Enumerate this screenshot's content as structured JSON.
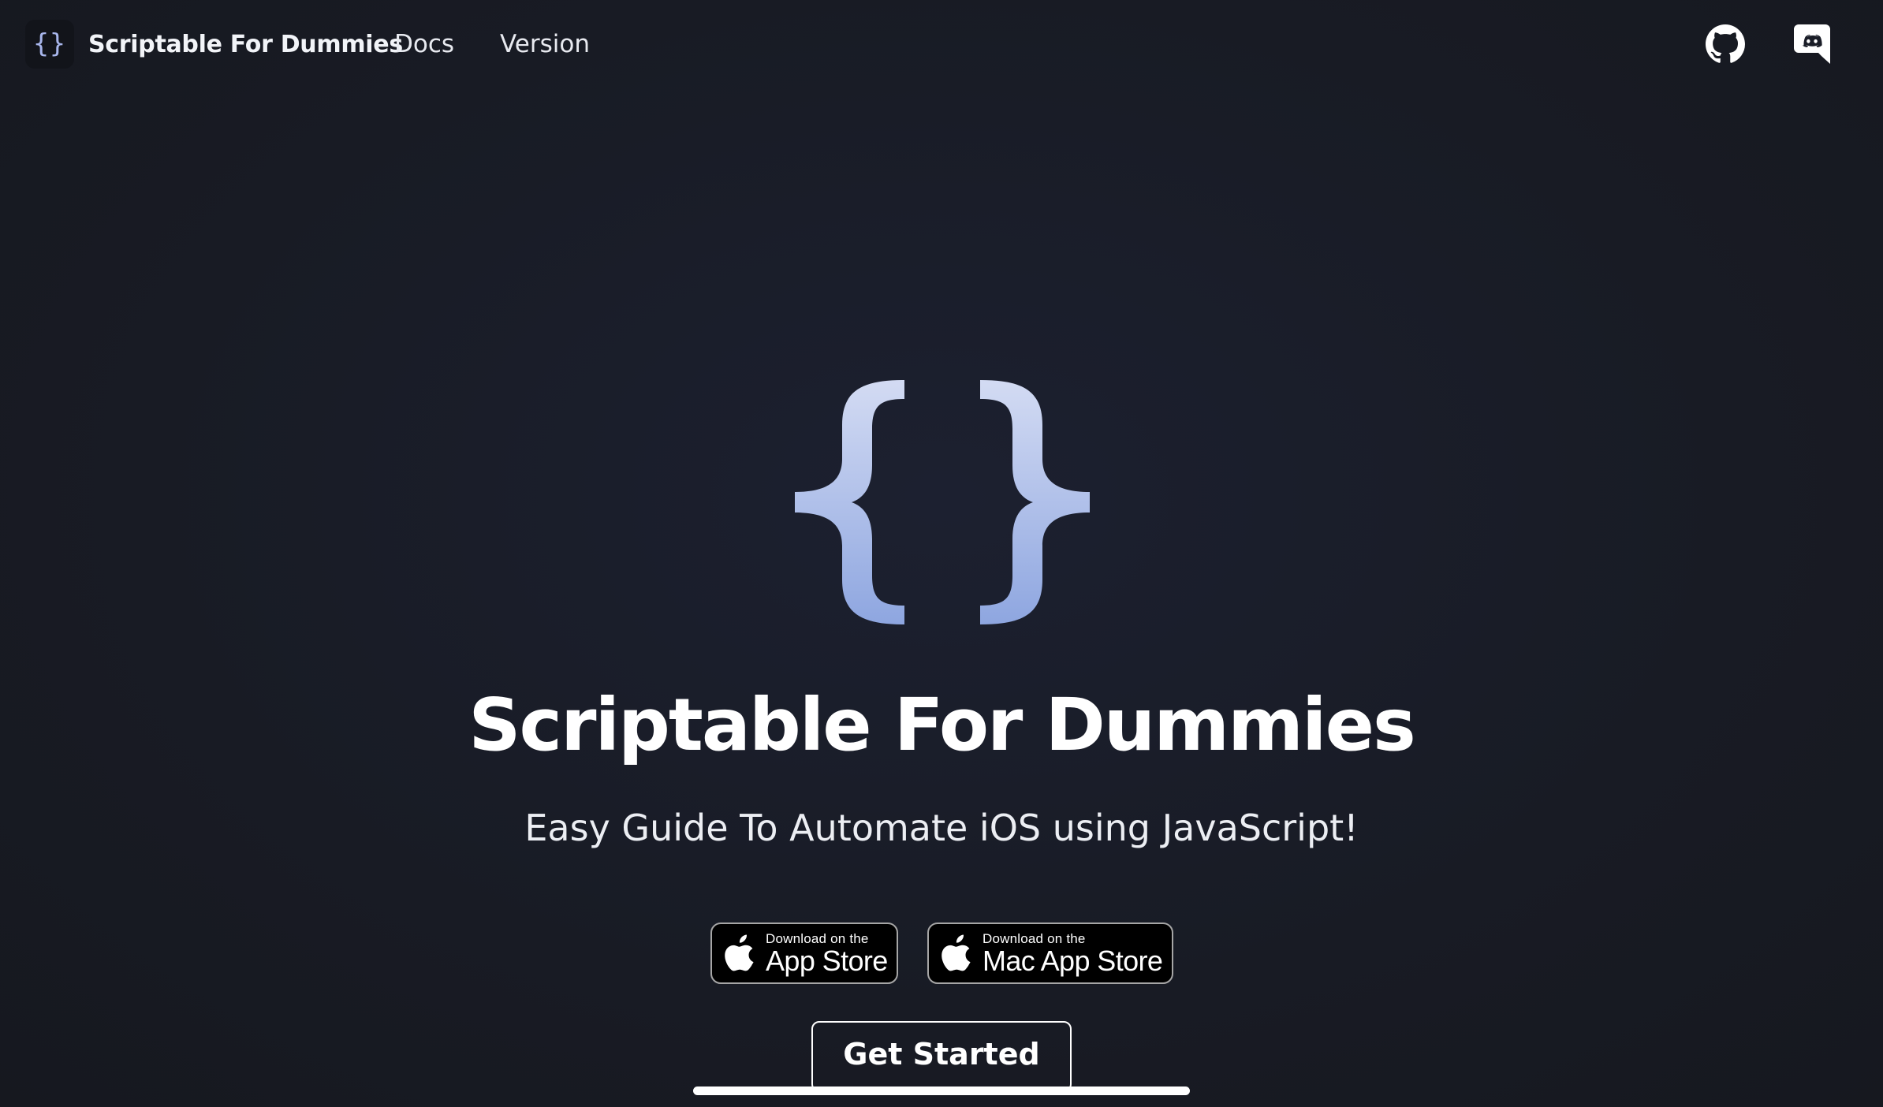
{
  "navbar": {
    "brand_logo_text": "{}",
    "brand_title": "Scriptable For Dummies",
    "links": [
      {
        "label": "Docs"
      },
      {
        "label": "Version"
      }
    ],
    "icons": [
      "github-icon",
      "discord-icon"
    ]
  },
  "hero": {
    "logo_icon": "curly-braces-logo",
    "title": "Scriptable For Dummies",
    "subtitle": "Easy Guide To Automate iOS using JavaScript!",
    "badges": {
      "ios": {
        "small": "Download on the",
        "big": "App Store"
      },
      "mac": {
        "small": "Download on the",
        "big": "Mac App Store"
      }
    },
    "cta_label": "Get Started"
  },
  "colors": {
    "background": "#1a1d27",
    "brace_gradient_top": "#d3dbf3",
    "brace_gradient_bottom": "#8ea6e0",
    "text": "#ffffff"
  }
}
